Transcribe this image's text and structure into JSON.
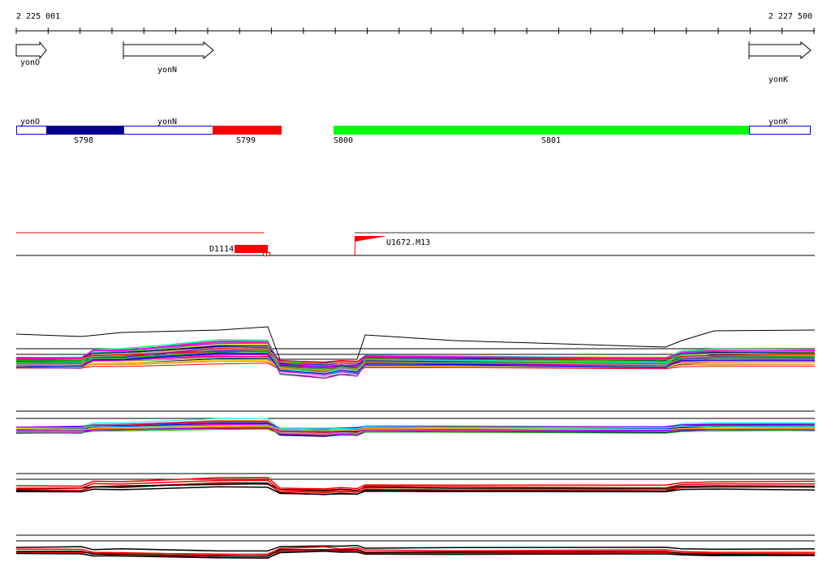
{
  "ruler": {
    "start_label": "2 225 001",
    "end_label": "2 227 500",
    "tick_count": 26
  },
  "genes": [
    {
      "name": "yonO",
      "strand": "+"
    },
    {
      "name": "yonN",
      "strand": "+"
    },
    {
      "name": "yonK",
      "strand": "+"
    }
  ],
  "segments": {
    "gene_labels": [
      "yonO",
      "yonN",
      "yonK"
    ],
    "items": [
      {
        "name": "S798",
        "color": "#00008b"
      },
      {
        "name": "S799",
        "color": "#ff0000"
      },
      {
        "name": "S800",
        "color": "#00ff00"
      },
      {
        "name": "S801",
        "color": "#00ff00"
      }
    ]
  },
  "features": [
    {
      "name": "D1114",
      "color": "#ff0000"
    },
    {
      "name": "U1672.M13",
      "color": "#ff0000"
    }
  ],
  "tracks": [
    "expression-profiles-1",
    "expression-profiles-2",
    "expression-profiles-3",
    "expression-profiles-4"
  ]
}
